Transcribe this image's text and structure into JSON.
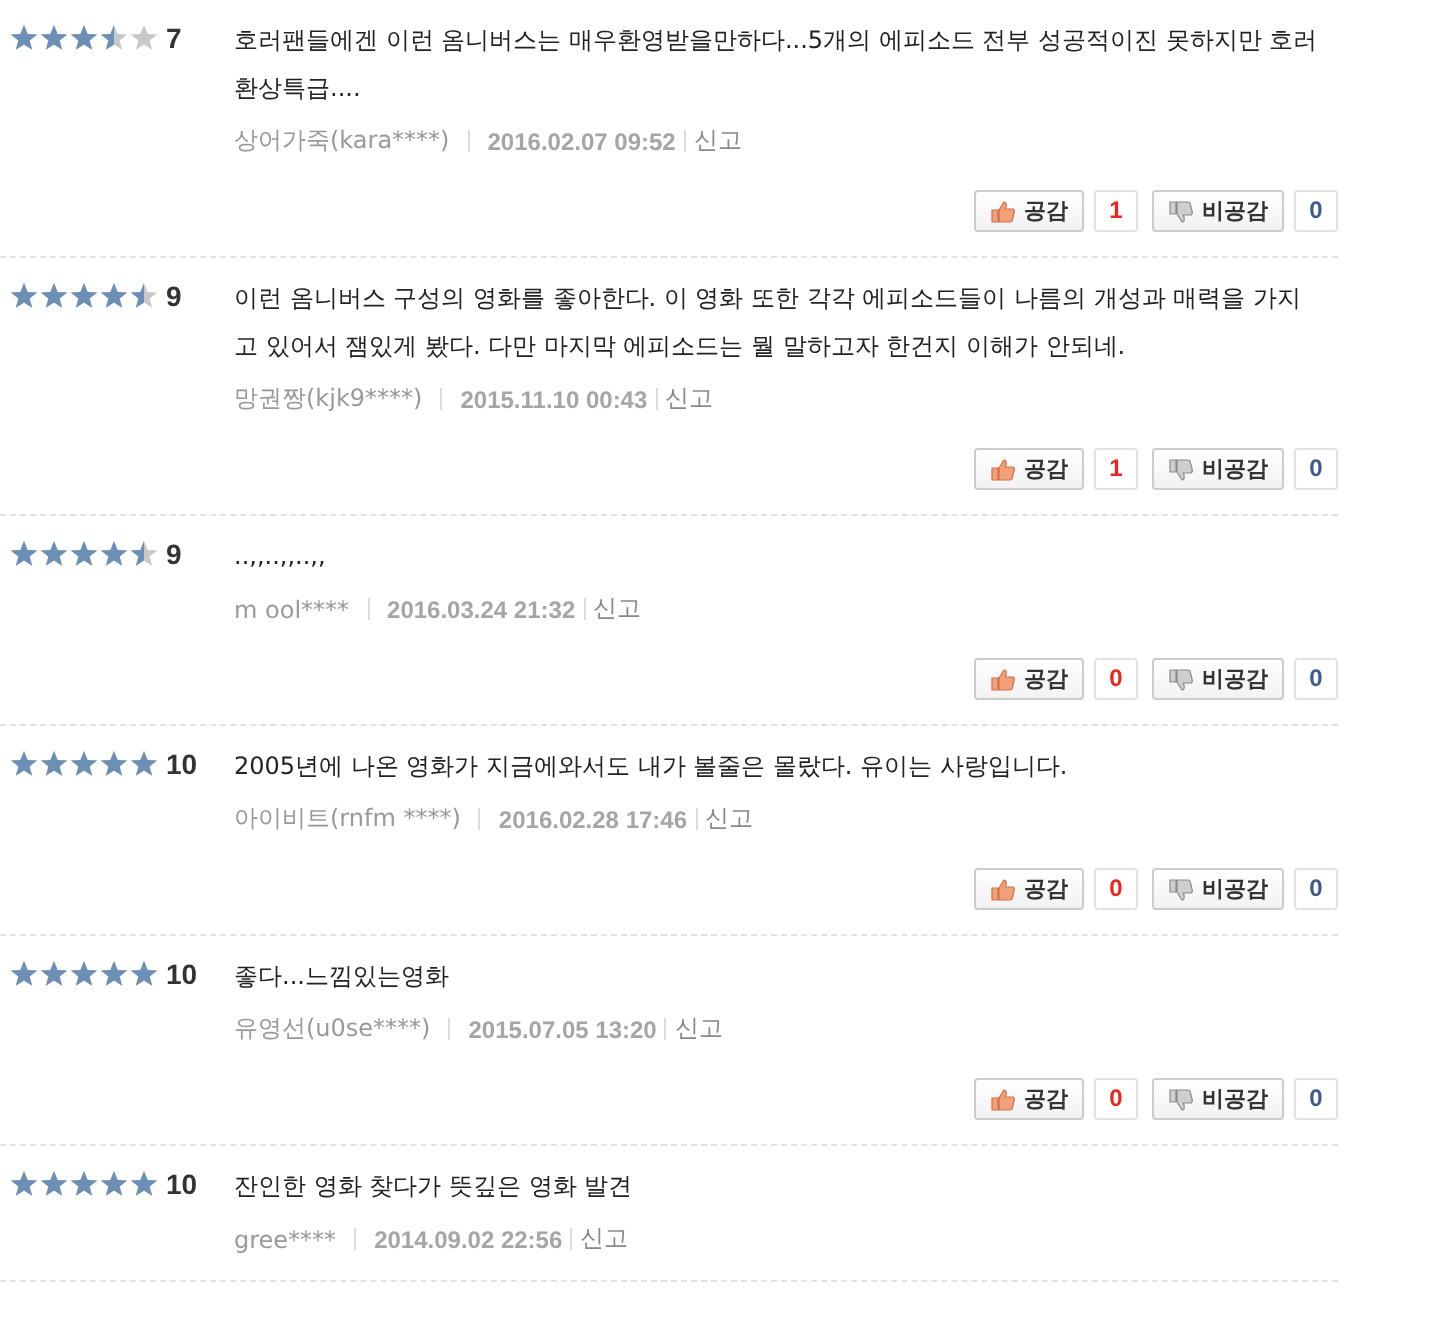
{
  "reviews": [
    {
      "stars": 3.5,
      "score": "7",
      "text": "호러팬들에겐 이런 옴니버스는 매우환영받을만하다...5개의 에피소드 전부 성공적이진 못하지만 호러환상특급....",
      "author": "상어가죽(kara****)",
      "date": "2016.02.07 09:52",
      "report": "신고",
      "like_label": "공감",
      "like_count": "1",
      "dislike_label": "비공감",
      "dislike_count": "0"
    },
    {
      "stars": 4.5,
      "score": "9",
      "text": "이런 옴니버스 구성의 영화를 좋아한다. 이 영화 또한 각각 에피소드들이 나름의 개성과 매력을 가지고 있어서 잼있게 봤다. 다만 마지막 에피소드는 뭘 말하고자 한건지 이해가 안되네.",
      "author": "망권짱(kjk9****)",
      "date": "2015.11.10 00:43",
      "report": "신고",
      "like_label": "공감",
      "like_count": "1",
      "dislike_label": "비공감",
      "dislike_count": "0"
    },
    {
      "stars": 4.5,
      "score": "9",
      "text": "..,,..,,..,,",
      "author": "m ool****",
      "date": "2016.03.24 21:32",
      "report": "신고",
      "like_label": "공감",
      "like_count": "0",
      "dislike_label": "비공감",
      "dislike_count": "0"
    },
    {
      "stars": 5,
      "score": "10",
      "text": "2005년에 나온 영화가 지금에와서도 내가 볼줄은 몰랐다. 유이는 사랑입니다.",
      "author": "아이비트(rnfm ****)",
      "date": "2016.02.28 17:46",
      "report": "신고",
      "like_label": "공감",
      "like_count": "0",
      "dislike_label": "비공감",
      "dislike_count": "0"
    },
    {
      "stars": 5,
      "score": "10",
      "text": "좋다...느낌있는영화",
      "author": "유영선(u0se****)",
      "date": "2015.07.05 13:20",
      "report": "신고",
      "like_label": "공감",
      "like_count": "0",
      "dislike_label": "비공감",
      "dislike_count": "0"
    },
    {
      "stars": 5,
      "score": "10",
      "text": "잔인한 영화 찾다가 뜻깊은 영화 발견",
      "author": "gree****",
      "date": "2014.09.02 22:56",
      "report": "신고"
    }
  ]
}
